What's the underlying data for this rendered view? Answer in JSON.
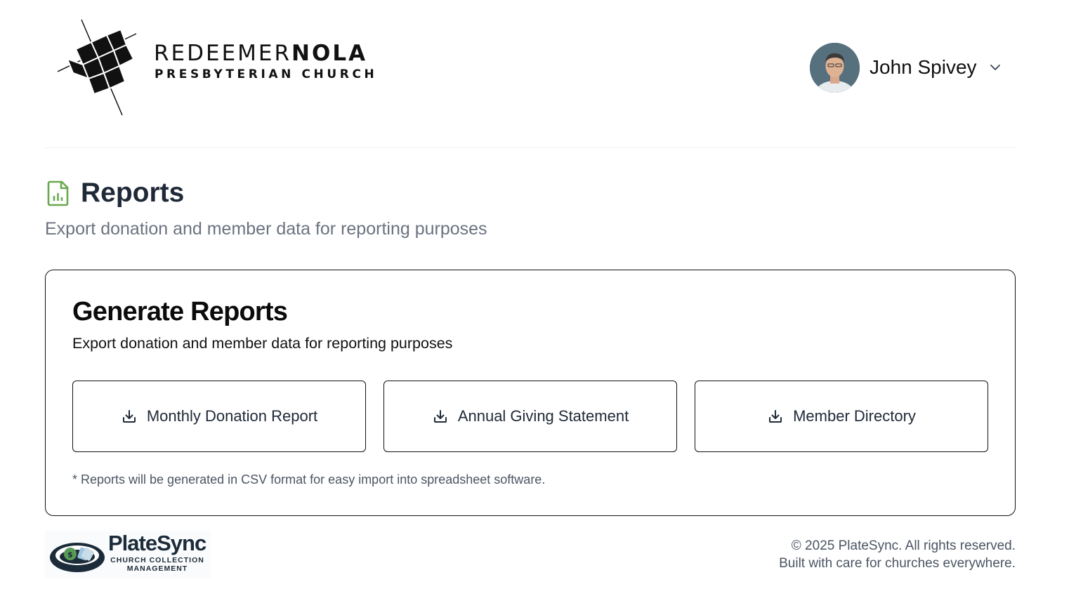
{
  "header": {
    "church_logo": {
      "word_bold_light": "REDEEMER",
      "word_bold_heavy": "NOLA",
      "subtitle": "PRESBYTERIAN CHURCH"
    },
    "user": {
      "name": "John Spivey"
    }
  },
  "page": {
    "title": "Reports",
    "subtitle": "Export donation and member data for reporting purposes",
    "title_icon_color": "#6aa84f"
  },
  "card": {
    "title": "Generate Reports",
    "description": "Export donation and member data for reporting purposes",
    "buttons": [
      {
        "label": "Monthly Donation Report",
        "icon": "download-icon"
      },
      {
        "label": "Annual Giving Statement",
        "icon": "download-icon"
      },
      {
        "label": "Member Directory",
        "icon": "download-icon"
      }
    ],
    "note": "* Reports will be generated in CSV format for easy import into spreadsheet software."
  },
  "footer": {
    "brand": {
      "name": "PlateSync",
      "tagline": "CHURCH COLLECTION MANAGEMENT"
    },
    "copyright": "© 2025 PlateSync. All rights reserved.",
    "tagline": "Built with care for churches everywhere."
  }
}
